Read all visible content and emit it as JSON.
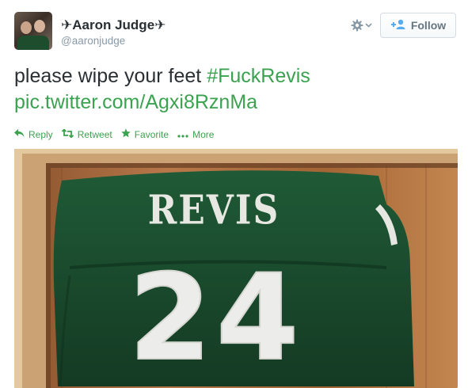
{
  "tweet": {
    "display_name": "✈Aaron Judge✈",
    "username": "@aaronjudge",
    "text_plain": "please wipe your feet ",
    "hashtag": "#FuckRevis",
    "link": "pic.twitter.com/Agxi8RznMa"
  },
  "header": {
    "follow_label": "Follow",
    "gear_icon": "gear-icon"
  },
  "actions": {
    "reply": "Reply",
    "retweet": "Retweet",
    "favorite": "Favorite",
    "more": "More"
  },
  "photo": {
    "jersey_name": "REVIS",
    "jersey_number": "24"
  },
  "colors": {
    "accent": "#3ba24f",
    "text": "#292f33",
    "muted": "#8899a6",
    "jersey_green": "#1c4a2e"
  }
}
